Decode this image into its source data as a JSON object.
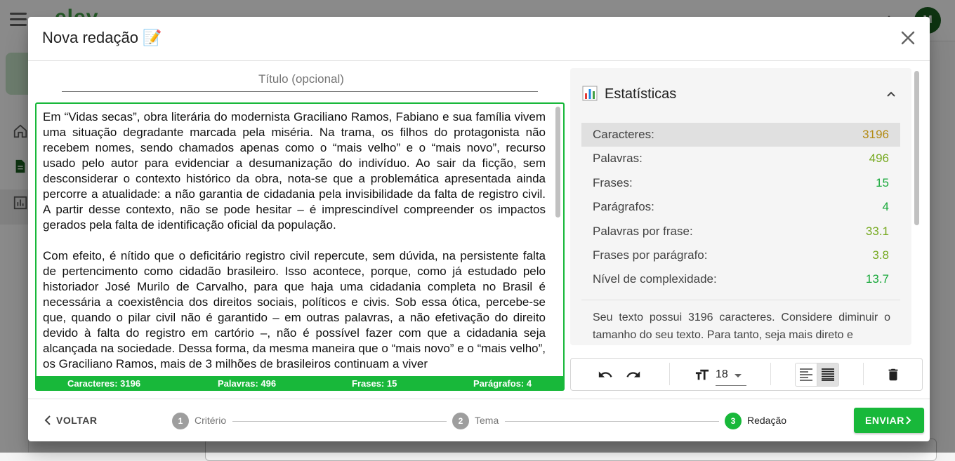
{
  "background": {
    "logo_text": "elev",
    "avatar_initials": "M"
  },
  "dialog": {
    "title": "Nova redação 📝",
    "close_icon": "close-icon"
  },
  "editor": {
    "title_placeholder": "Título (opcional)",
    "paragraphs": [
      "Em “Vidas secas”, obra literária do modernista Graciliano Ramos, Fabiano e sua família vivem uma situação degradante marcada pela miséria. Na trama, os filhos do protagonista não recebem nomes, sendo chamados apenas como o “mais velho” e o “mais novo”, recurso usado pelo autor para evidenciar a desumanização do indivíduo. Ao sair da ficção, sem desconsiderar o contexto histórico da obra, nota-se que a problemática apresentada ainda percorre a atualidade: a não garantia de cidadania pela invisibilidade da falta de registro civil. A partir desse contexto, não se pode hesitar – é imprescindível compreender os impactos gerados pela falta de identificação oficial da população.",
      "Com efeito, é nítido que o deficitário registro civil repercute, sem dúvida, na persistente falta de pertencimento como cidadão brasileiro. Isso acontece, porque, como já estudado pelo historiador José Murilo de Carvalho, para que haja uma cidadania completa no Brasil é necessária a coexistência dos direitos sociais, políticos e civis. Sob essa ótica, percebe-se que, quando o pilar civil não é garantido – em outras palavras, a não efetivação do direito devido à falta do registro em cartório –, não é possível fazer com que a cidadania seja alcançada na sociedade. Dessa forma, da mesma maneira que o “mais novo” e o “mais velho”, os Graciliano Ramos, mais de 3 milhões de brasileiros continuam a viver"
    ],
    "status": {
      "characters": "Caracteres: 3196",
      "words": "Palavras: 496",
      "sentences": "Frases: 15",
      "paragraphs": "Parágrafos: 4"
    }
  },
  "stats": {
    "icon": "bar-chart-icon",
    "title": "Estatísticas",
    "rows": [
      {
        "label": "Caracteres:",
        "value": "3196",
        "color": "#b38b14"
      },
      {
        "label": "Palavras:",
        "value": "496",
        "color": "#76a91f"
      },
      {
        "label": "Frases:",
        "value": "15",
        "color": "#18a83a"
      },
      {
        "label": "Parágrafos:",
        "value": "4",
        "color": "#18a83a"
      },
      {
        "label": "Palavras por frase:",
        "value": "33.1",
        "color": "#76a91f"
      },
      {
        "label": "Frases por parágrafo:",
        "value": "3.8",
        "color": "#76a91f"
      },
      {
        "label": "Nível de complexidade:",
        "value": "13.7",
        "color": "#18a83a"
      }
    ],
    "description": "Seu texto possui 3196 caracteres. Considere diminuir o tamanho do seu texto. Para tanto, seja mais direto e"
  },
  "toolbar": {
    "undo_icon": "undo-icon",
    "redo_icon": "redo-icon",
    "font_size_icon": "text-size-icon",
    "font_size": "18",
    "align_left_icon": "align-left-icon",
    "align_justify_icon": "align-justify-icon",
    "delete_icon": "trash-icon"
  },
  "footer": {
    "back_label": "VOLTAR",
    "steps": [
      {
        "number": "1",
        "label": "Critério",
        "state": "done"
      },
      {
        "number": "2",
        "label": "Tema",
        "state": "done"
      },
      {
        "number": "3",
        "label": "Redação",
        "state": "active"
      }
    ],
    "send_label": "ENVIAR",
    "colors": {
      "accent": "#18b83a",
      "inactive_step": "#9e9e9e"
    }
  }
}
